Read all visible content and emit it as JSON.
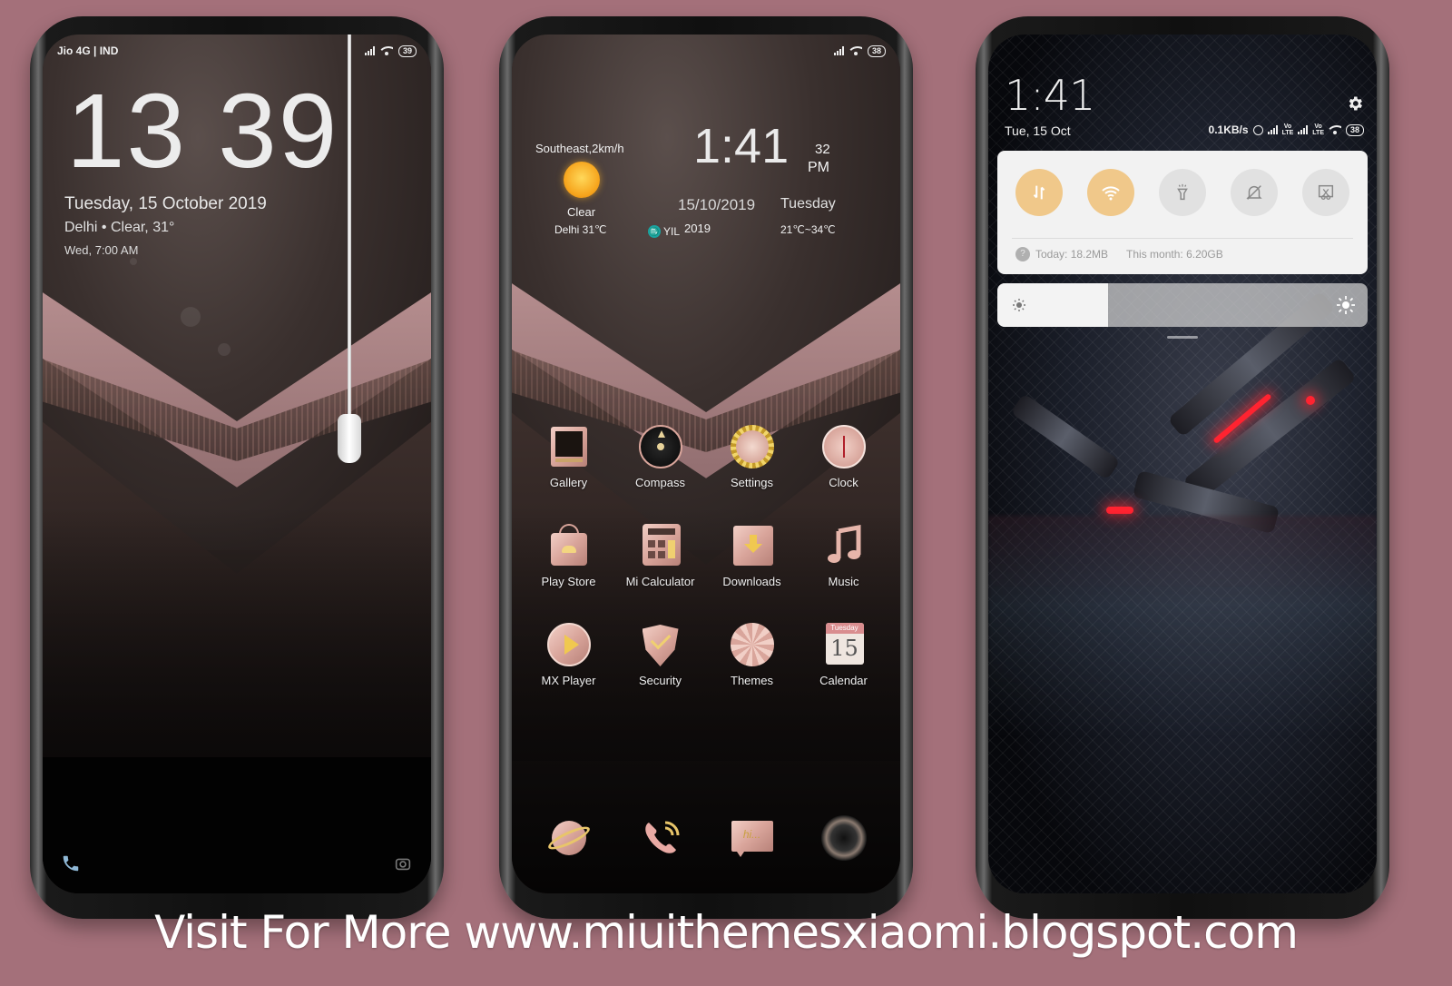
{
  "phones": {
    "lockscreen": {
      "status": {
        "carrier": "Jio 4G | IND",
        "battery": "39"
      },
      "time": "13 39",
      "date": "Tuesday, 15 October 2019",
      "weather": "Delhi • Clear, 31°",
      "alarm": "Wed, 7:00 AM",
      "bottom_icons": [
        "phone-icon",
        "camera-icon"
      ]
    },
    "homescreen": {
      "status": {
        "battery": "38"
      },
      "weather": {
        "wind": "Southeast,2km/h",
        "condition": "Clear",
        "city_temp": "Delhi 31℃"
      },
      "clock": {
        "time": "1:41",
        "seconds": "32",
        "ampm": "PM",
        "date": "15/10/2019",
        "day": "Tuesday",
        "zodiac_symbol": "♏",
        "zodiac": "YIL",
        "year": "2019",
        "temp_range": "21℃~34℃"
      },
      "apps": [
        {
          "label": "Gallery",
          "icon": "gallery-icon"
        },
        {
          "label": "Compass",
          "icon": "compass-icon"
        },
        {
          "label": "Settings",
          "icon": "settings-icon"
        },
        {
          "label": "Clock",
          "icon": "clock-icon"
        },
        {
          "label": "Play Store",
          "icon": "play-store-icon"
        },
        {
          "label": "Mi Calculator",
          "icon": "calculator-icon"
        },
        {
          "label": "Downloads",
          "icon": "downloads-icon"
        },
        {
          "label": "Music",
          "icon": "music-icon"
        },
        {
          "label": "MX Player",
          "icon": "mx-player-icon"
        },
        {
          "label": "Security",
          "icon": "security-icon"
        },
        {
          "label": "Themes",
          "icon": "themes-icon"
        },
        {
          "label": "Calendar",
          "icon": "calendar-icon"
        }
      ],
      "calendar_icon": {
        "day": "Tuesday",
        "date": "15"
      },
      "dock": [
        {
          "icon": "browser-icon"
        },
        {
          "icon": "phone-icon"
        },
        {
          "icon": "messaging-icon",
          "text": "hi..."
        },
        {
          "icon": "camera-icon"
        }
      ]
    },
    "notification_shade": {
      "time": "1:41",
      "date": "Tue, 15 Oct",
      "network_speed": "0.1KB/s",
      "battery": "38",
      "volte_label": "Vo\nLTE",
      "quick_settings": [
        {
          "name": "mobile-data",
          "icon": "mobile-data-icon",
          "active": true
        },
        {
          "name": "wifi",
          "icon": "wifi-icon",
          "active": true
        },
        {
          "name": "flashlight",
          "icon": "flashlight-icon",
          "active": false
        },
        {
          "name": "silent",
          "icon": "silent-icon",
          "active": false
        },
        {
          "name": "screenshot",
          "icon": "screenshot-icon",
          "active": false
        }
      ],
      "data_usage": {
        "today": "Today: 18.2MB",
        "month": "This month: 6.20GB",
        "help": "?"
      },
      "brightness_level": 0.3,
      "colors": {
        "active_tile": "#f0c88a",
        "inactive_tile": "#e1e1e1"
      }
    }
  },
  "footer": {
    "promo": "Visit For More www.miuithemesxiaomi.blogspot.com"
  },
  "colors": {
    "background": "#a4707a",
    "rose_gold": "#d9a59b"
  }
}
